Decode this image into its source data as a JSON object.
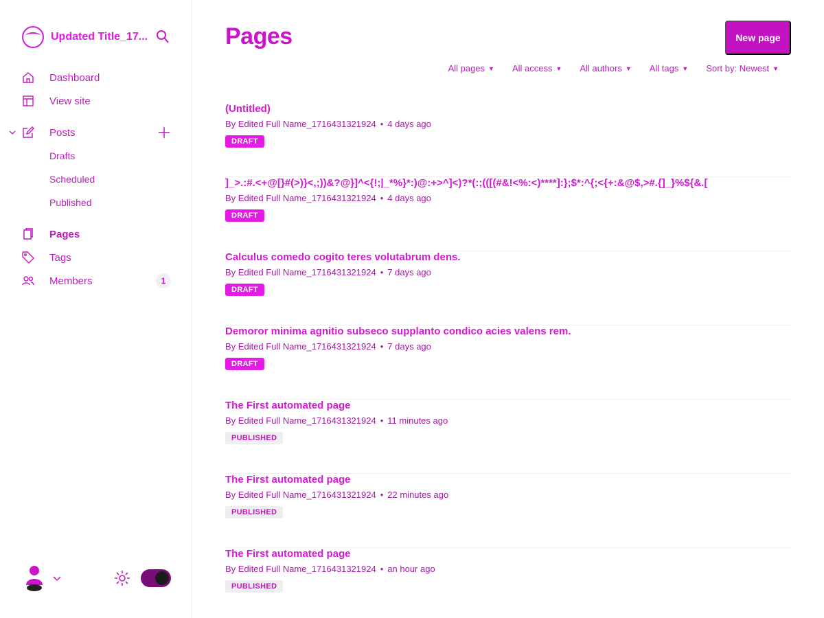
{
  "brand": {
    "title": "Updated Title_17..."
  },
  "sidebar": {
    "dashboard": "Dashboard",
    "view_site": "View site",
    "posts": "Posts",
    "drafts": "Drafts",
    "scheduled": "Scheduled",
    "published": "Published",
    "pages": "Pages",
    "tags": "Tags",
    "members": "Members",
    "members_count": "1"
  },
  "header": {
    "title": "Pages",
    "new_page": "New page"
  },
  "filters": [
    "All pages",
    "All access",
    "All authors",
    "All tags",
    "Sort by: Newest"
  ],
  "pages": [
    {
      "title": "(Untitled)",
      "author": "By Edited Full Name_1716431321924",
      "time": "4 days ago",
      "status": "DRAFT"
    },
    {
      "title": "]_>.:#.<+@[}#(>)}<,;))&?@}]^<{!;|_*%}*:)@:+>^]<)?*(:;(([(#&!<%:<)****]:};$*:^{;<{+:&@$,>#.{]_}%${&.[",
      "author": "By Edited Full Name_1716431321924",
      "time": "4 days ago",
      "status": "DRAFT"
    },
    {
      "title": "Calculus comedo cogito teres volutabrum dens.",
      "author": "By Edited Full Name_1716431321924",
      "time": "7 days ago",
      "status": "DRAFT"
    },
    {
      "title": "Demoror minima agnitio subseco supplanto condico acies valens rem.",
      "author": "By Edited Full Name_1716431321924",
      "time": "7 days ago",
      "status": "DRAFT"
    },
    {
      "title": "The First automated page",
      "author": "By Edited Full Name_1716431321924",
      "time": "11 minutes ago",
      "status": "PUBLISHED"
    },
    {
      "title": "The First automated page",
      "author": "By Edited Full Name_1716431321924",
      "time": "22 minutes ago",
      "status": "PUBLISHED"
    },
    {
      "title": "The First automated page",
      "author": "By Edited Full Name_1716431321924",
      "time": "an hour ago",
      "status": "PUBLISHED"
    }
  ],
  "colors": {
    "accent": "#c212c2",
    "draft_badge": "#e61ae6",
    "published_badge": "#eeeef1"
  },
  "icons": {
    "dashboard": "home-icon",
    "view_site": "layout-icon",
    "posts": "edit-icon",
    "pages": "page-icon",
    "tags": "tag-icon",
    "members": "members-icon",
    "search": "search-icon",
    "settings": "gear-icon"
  }
}
